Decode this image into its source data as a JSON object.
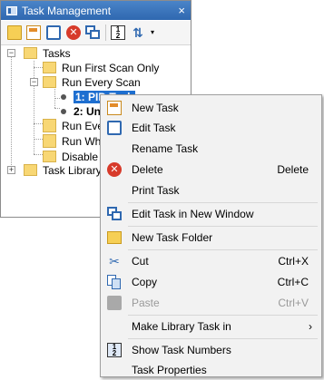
{
  "panel": {
    "title": "Task Management",
    "close_glyph": "×",
    "toolbar": {
      "delete_glyph": "✕",
      "numbers_glyph": "1\n2",
      "sort_glyph": "⇅",
      "dropdown_glyph": "▾"
    }
  },
  "tree": {
    "root_label": "Tasks",
    "items": [
      {
        "label": "Run First Scan Only"
      },
      {
        "label": "Run Every Scan"
      },
      {
        "label": "1: PID Task"
      },
      {
        "label": "2: Un"
      },
      {
        "label": "Run Every"
      },
      {
        "label": "Run When"
      },
      {
        "label": "Disable Ta"
      }
    ],
    "library_label": "Task Library",
    "expand_glyph": "+",
    "collapse_glyph": "−"
  },
  "menu": {
    "items": [
      {
        "label": "New Task",
        "icon": "new-task-icon"
      },
      {
        "label": "Edit Task",
        "icon": "edit-task-icon"
      },
      {
        "label": "Rename Task"
      },
      {
        "label": "Delete",
        "shortcut": "Delete",
        "icon": "delete-icon"
      },
      {
        "label": "Print Task"
      },
      {
        "label": "Edit Task in New Window",
        "icon": "new-window-icon"
      },
      {
        "label": "New Task Folder",
        "icon": "folder-icon"
      },
      {
        "label": "Cut",
        "shortcut": "Ctrl+X",
        "icon": "cut-icon"
      },
      {
        "label": "Copy",
        "shortcut": "Ctrl+C",
        "icon": "copy-icon"
      },
      {
        "label": "Paste",
        "shortcut": "Ctrl+V",
        "icon": "paste-icon",
        "disabled": true
      },
      {
        "label": "Make Library Task in",
        "submenu_glyph": "›"
      },
      {
        "label": "Show Task Numbers",
        "icon": "task-numbers-icon"
      },
      {
        "label": "Task Properties"
      }
    ],
    "delete_glyph": "✕",
    "cut_glyph": "✂",
    "numbers_glyph": "1\n2"
  },
  "colors": {
    "selection": "#1e6fd0",
    "titlebar": "#2f68b0",
    "menu_background": "#f2f2f2"
  }
}
